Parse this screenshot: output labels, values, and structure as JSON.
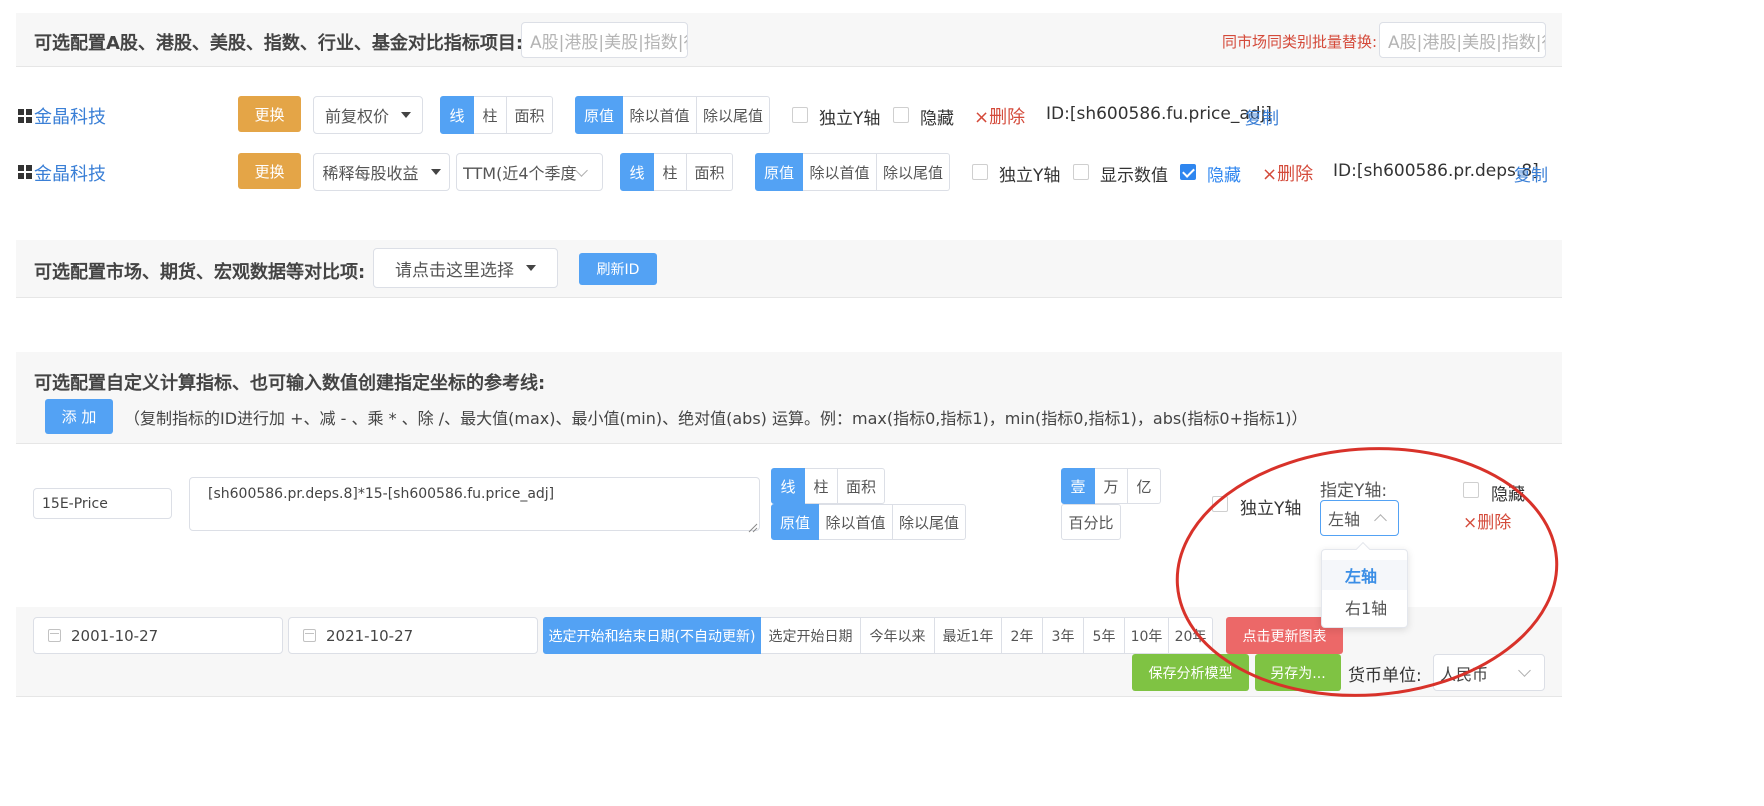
{
  "section_stocks": {
    "label": "可选配置A股、港股、美股、指数、行业、基金对比指标项目:",
    "search_placeholder": "A股|港股|美股|指数|行业",
    "batch_label": "同市场同类别批量替换:",
    "batch_placeholder": "A股|港股|美股|指数|行业"
  },
  "indicators": [
    {
      "name": "金晶科技",
      "replace_label": "更换",
      "metric": "前复权价",
      "chart_types": [
        "线",
        "柱",
        "面积"
      ],
      "value_modes": [
        "原值",
        "除以首值",
        "除以尾值"
      ],
      "independent_y": "独立Y轴",
      "hide": "隐藏",
      "delete": "×删除",
      "id_text": "ID:[sh600586.fu.price_adj]",
      "copy": "复制"
    },
    {
      "name": "金晶科技",
      "replace_label": "更换",
      "metric": "稀释每股收益",
      "period": "TTM(近4个季度累",
      "chart_types": [
        "线",
        "柱",
        "面积"
      ],
      "value_modes": [
        "原值",
        "除以首值",
        "除以尾值"
      ],
      "independent_y": "独立Y轴",
      "show_value": "显示数值",
      "hide": "隐藏",
      "delete": "×删除",
      "id_text": "ID:[sh600586.pr.deps.8]",
      "copy": "复制"
    }
  ],
  "section_market": {
    "label": "可选配置市场、期货、宏观数据等对比项:",
    "select_placeholder": "请点击这里选择",
    "refresh_label": "刷新ID"
  },
  "section_custom": {
    "label": "可选配置自定义计算指标、也可输入数值创建指定坐标的参考线:",
    "add_label": "添 加",
    "hint": "（复制指标的ID进行加 +、减 - 、乘 * 、除 /、最大值(max)、最小值(min)、绝对值(abs) 运算。例：max(指标0,指标1)，min(指标0,指标1)，abs(指标0+指标1)）"
  },
  "custom_row": {
    "name_value": "15E-Price",
    "formula_value": "[sh600586.pr.deps.8]*15-[sh600586.fu.price_adj]",
    "chart_types": [
      "线",
      "柱",
      "面积"
    ],
    "value_modes": [
      "原值",
      "除以首值",
      "除以尾值"
    ],
    "units": [
      "壹",
      "万",
      "亿"
    ],
    "percent_label": "百分比",
    "independent_y": "独立Y轴",
    "y_axis_label": "指定Y轴:",
    "y_axis_value": "左轴",
    "hide": "隐藏",
    "delete": "×删除",
    "dropdown_options": [
      "左轴",
      "右1轴"
    ]
  },
  "date_bar": {
    "start_date": "2001-10-27",
    "end_date": "2021-10-27",
    "ranges": [
      "选定开始和结束日期(不自动更新)",
      "选定开始日期",
      "今年以来",
      "最近1年",
      "2年",
      "3年",
      "5年",
      "10年",
      "20年"
    ],
    "update_label": "点击更新图表",
    "save_model_label": "保存分析模型",
    "save_as_label": "另存为...",
    "currency_label": "货币单位:",
    "currency_value": "人民币"
  },
  "colors": {
    "accent_blue": "#53a2f4",
    "orange": "#e4a547",
    "green": "#7fc343",
    "red": "#ec6868",
    "annotation_red": "#d8322a"
  }
}
